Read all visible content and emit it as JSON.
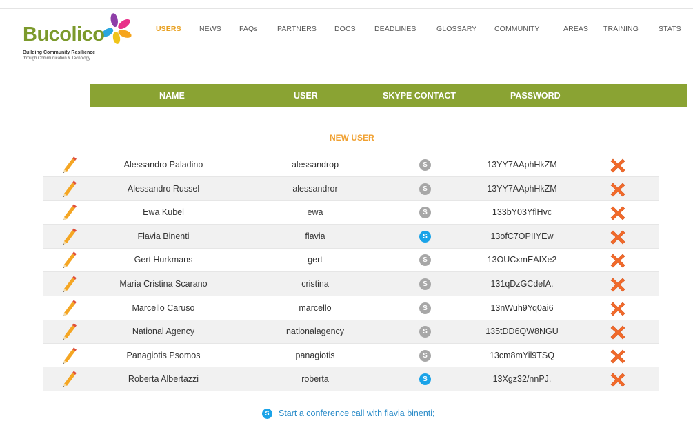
{
  "brand": {
    "name": "Bucolico",
    "tagline1": "Building Community Resilience",
    "tagline2": "through Communication & Tecnology"
  },
  "nav": {
    "items": [
      "USERS",
      "NEWS",
      "FAQs",
      "PARTNERS",
      "DOCS",
      "DEADLINES",
      "GLOSSARY",
      "COMMUNITY",
      "AREAS",
      "TRAINING",
      "STATS"
    ],
    "active": "USERS"
  },
  "table": {
    "headers": [
      "NAME",
      "USER",
      "SKYPE CONTACT",
      "PASSWORD"
    ],
    "new_user_label": "NEW USER",
    "rows": [
      {
        "name": "Alessandro Paladino",
        "user": "alessandrop",
        "skype_online": false,
        "password": "13YY7AAphHkZM"
      },
      {
        "name": "Alessandro Russel",
        "user": "alessandror",
        "skype_online": false,
        "password": "13YY7AAphHkZM"
      },
      {
        "name": "Ewa Kubel",
        "user": "ewa",
        "skype_online": false,
        "password": "133bY03YflHvc"
      },
      {
        "name": "Flavia Binenti",
        "user": "flavia",
        "skype_online": true,
        "password": "13ofC7OPIIYEw"
      },
      {
        "name": "Gert Hurkmans",
        "user": "gert",
        "skype_online": false,
        "password": "13OUCxmEAIXe2"
      },
      {
        "name": "Maria Cristina Scarano",
        "user": "cristina",
        "skype_online": false,
        "password": "131qDzGCdefA."
      },
      {
        "name": "Marcello Caruso",
        "user": "marcello",
        "skype_online": false,
        "password": "13nWuh9Yq0ai6"
      },
      {
        "name": "National Agency",
        "user": "nationalagency",
        "skype_online": false,
        "password": "135tDD6QW8NGU"
      },
      {
        "name": "Panagiotis Psomos",
        "user": "panagiotis",
        "skype_online": false,
        "password": "13cm8mYil9TSQ"
      },
      {
        "name": "Roberta Albertazzi",
        "user": "roberta",
        "skype_online": true,
        "password": "13Xgz32/nnPJ."
      }
    ]
  },
  "footer": {
    "conference_call": "Start a conference call with flavia binenti;"
  },
  "icons": {
    "edit": "pencil-icon",
    "delete": "delete-x-icon",
    "skype": "skype-icon"
  },
  "colors": {
    "header_bg": "#8aa333",
    "active_nav": "#e8a020",
    "new_user": "#f0a030",
    "delete": "#f26a2a",
    "skype_online": "#1aa3e8",
    "skype_offline": "#a7a7a7",
    "link": "#2a8bc8"
  }
}
